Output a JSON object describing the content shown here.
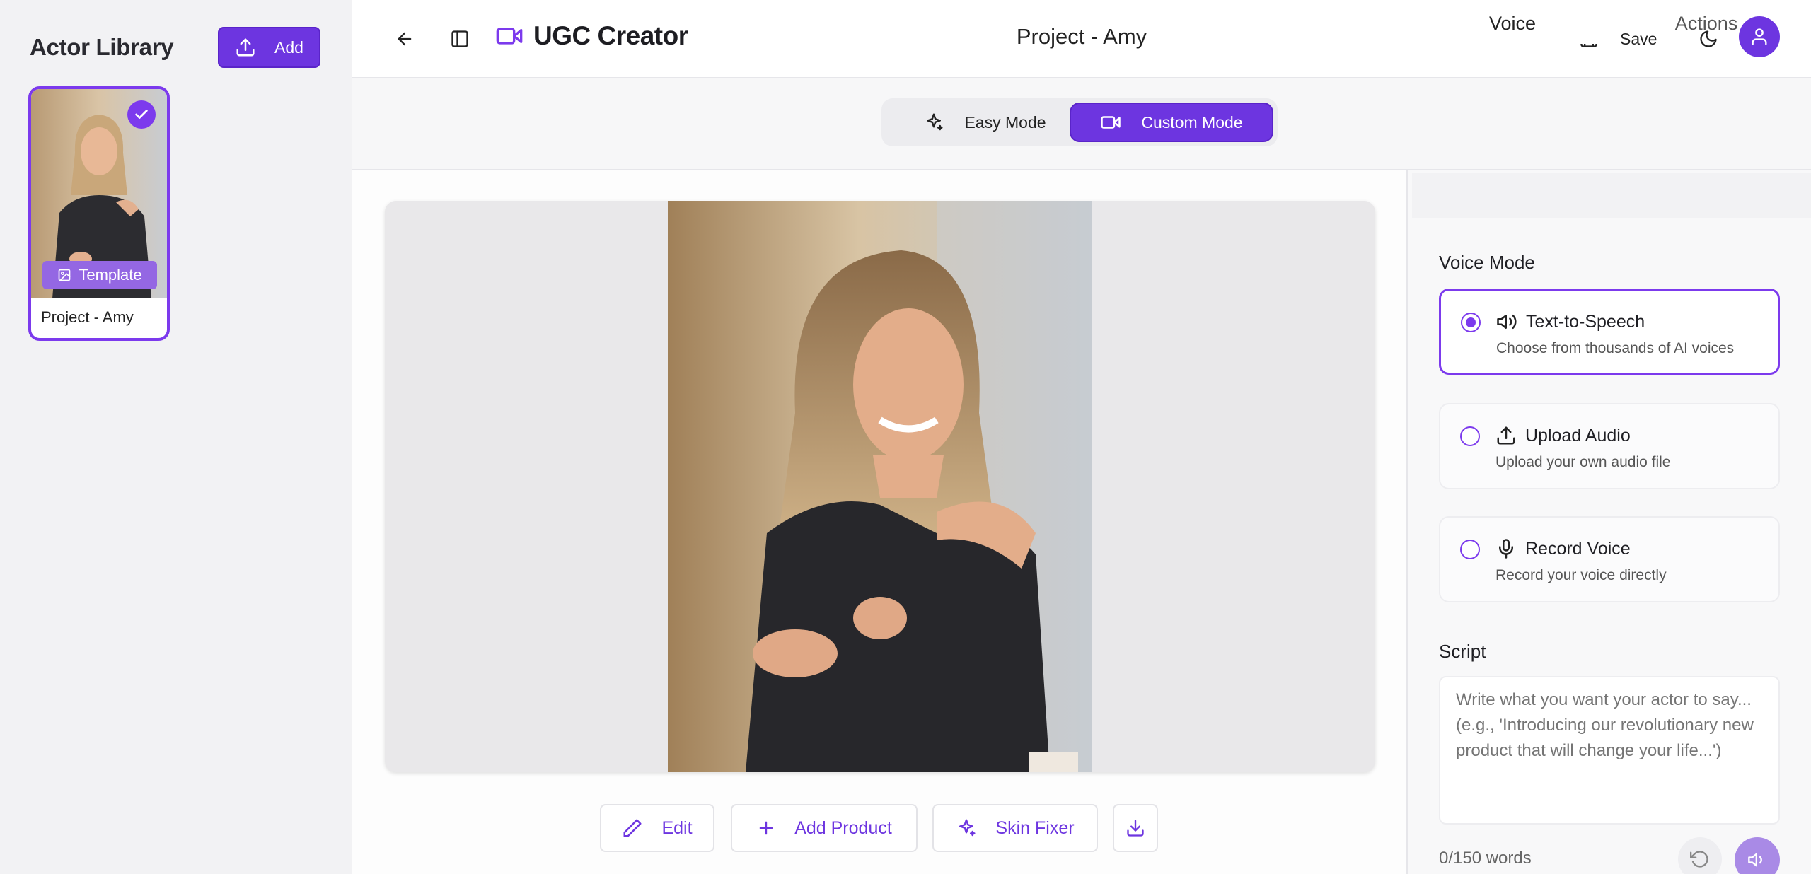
{
  "sidebar": {
    "title": "Actor Library",
    "add_label": "Add",
    "actors": [
      {
        "name": "Project - Amy",
        "badge": "Template",
        "selected": true
      }
    ]
  },
  "header": {
    "brand": "UGC Creator",
    "project_title": "Project - Amy",
    "save_label": "Save"
  },
  "modes": {
    "easy_label": "Easy Mode",
    "custom_label": "Custom Mode",
    "active": "Custom Mode"
  },
  "toolbar": {
    "edit_label": "Edit",
    "add_product_label": "Add Product",
    "skin_fixer_label": "Skin Fixer"
  },
  "panel": {
    "tabs": [
      "Voice",
      "Actions"
    ],
    "active_tab": "Voice",
    "voice_mode_label": "Voice Mode",
    "voice_options": [
      {
        "title": "Text-to-Speech",
        "subtitle": "Choose from thousands of AI voices",
        "icon": "speaker-icon",
        "selected": true
      },
      {
        "title": "Upload Audio",
        "subtitle": "Upload your own audio file",
        "icon": "upload-icon",
        "selected": false
      },
      {
        "title": "Record Voice",
        "subtitle": "Record your voice directly",
        "icon": "microphone-icon",
        "selected": false
      }
    ],
    "script_label": "Script",
    "script_placeholder": "Write what you want your actor to say... (e.g., 'Introducing our revolutionary new product that will change your life...')",
    "script_value": "",
    "word_count": "0/150 words"
  },
  "colors": {
    "accent": "#6d35e0",
    "accent_border": "#7c3aed",
    "badge": "#9467e3"
  }
}
